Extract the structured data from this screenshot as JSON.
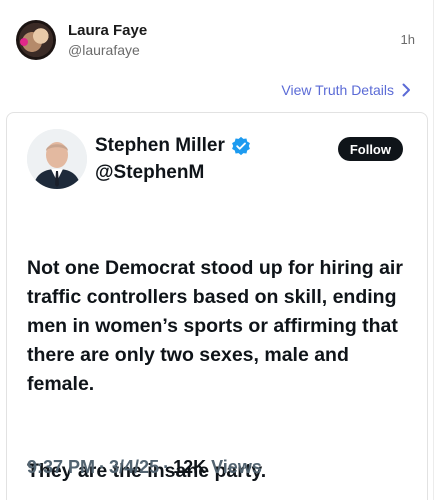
{
  "author": {
    "name": "Laura Faye",
    "handle": "@laurafaye",
    "time_ago": "1h"
  },
  "details_link": {
    "label": "View Truth Details"
  },
  "embedded_post": {
    "name": "Stephen Miller",
    "handle": "@StephenM",
    "follow_label": "Follow",
    "body": [
      "Not one Democrat stood up for hiring air traffic controllers based on skill, ending men in women’s sports or affirming that there are only two sexes, male and female.",
      "They are the insane party."
    ],
    "time": "9:37 PM",
    "date": "3/4/25",
    "views_count": "12K",
    "views_label": "Views",
    "separator": "·"
  },
  "colors": {
    "link": "#5b6bd6",
    "verified": "#1d9bf0",
    "muted": "#536471"
  },
  "icons": [
    "chevron-right-icon",
    "verified-badge-icon"
  ]
}
